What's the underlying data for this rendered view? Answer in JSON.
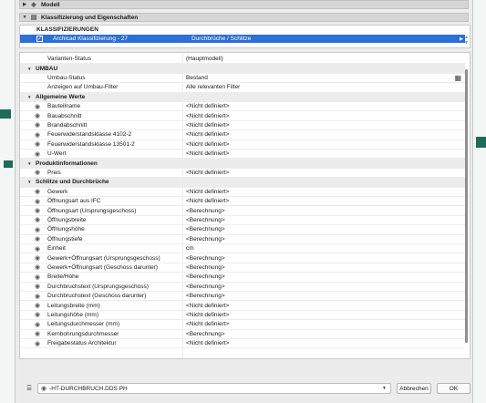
{
  "sections": {
    "modell": "Modell",
    "klassifizierung": "Klassifizierung und Eigenschaften"
  },
  "klassifizierungen": {
    "header": "KLASSIFIZIERUNGEN",
    "selected_name": "Archicad Klassifizierung - 27",
    "selected_value": "Durchbrüche / Schlitze"
  },
  "rows": [
    {
      "type": "prop",
      "name": "Varianten-Status",
      "value": "(Hauptmodell)",
      "eye": false
    },
    {
      "type": "group",
      "name": "UMBAU"
    },
    {
      "type": "prop",
      "name": "Umbau-Status",
      "value": "Bestand",
      "eye": false,
      "grid": true
    },
    {
      "type": "prop",
      "name": "Anzeigen auf Umbau-Filter",
      "value": "Alle relevanten Filter",
      "eye": false
    },
    {
      "type": "group",
      "name": "Allgemeine Werte"
    },
    {
      "type": "prop",
      "name": "Bauteilname",
      "value": "<Nicht definiert>",
      "eye": true
    },
    {
      "type": "prop",
      "name": "Bauabschnitt",
      "value": "<Nicht definiert>",
      "eye": true
    },
    {
      "type": "prop",
      "name": "Brandabschnitt",
      "value": "<Nicht definiert>",
      "eye": true
    },
    {
      "type": "prop",
      "name": "Feuerwiderstandsklasse 4102-2",
      "value": "<Nicht definiert>",
      "eye": true
    },
    {
      "type": "prop",
      "name": "Feuerwiderstandsklasse 13501-2",
      "value": "<Nicht definiert>",
      "eye": true
    },
    {
      "type": "prop",
      "name": "U-Wert",
      "value": "<Nicht definiert>",
      "eye": true
    },
    {
      "type": "group",
      "name": "Produktinformationen"
    },
    {
      "type": "prop",
      "name": "Preis",
      "value": "<Nicht definiert>",
      "eye": true
    },
    {
      "type": "group",
      "name": "Schlitze und Durchbrüche"
    },
    {
      "type": "prop",
      "name": "Gewerk",
      "value": "<Nicht definiert>",
      "eye": true
    },
    {
      "type": "prop",
      "name": "Öffnungsart aus IFC",
      "value": "<Nicht definiert>",
      "eye": true
    },
    {
      "type": "prop",
      "name": "Öffnungsart (Ursprungsgeschoss)",
      "value": "<Berechnung>",
      "eye": true
    },
    {
      "type": "prop",
      "name": "Öffnungsbreite",
      "value": "<Berechnung>",
      "eye": true
    },
    {
      "type": "prop",
      "name": "Öffnungshöhe",
      "value": "<Berechnung>",
      "eye": true
    },
    {
      "type": "prop",
      "name": "Öffnungstiefe",
      "value": "<Berechnung>",
      "eye": true
    },
    {
      "type": "prop",
      "name": "Einheit",
      "value": "cm",
      "eye": true
    },
    {
      "type": "prop",
      "name": "Gewerk+Öffnungsart (Ursprungsgeschoss)",
      "value": "<Berechnung>",
      "eye": true
    },
    {
      "type": "prop",
      "name": "Gewerk+Öffnungsart (Geschoss darunter)",
      "value": "<Berechnung>",
      "eye": true
    },
    {
      "type": "prop",
      "name": "Breite/Höhe",
      "value": "<Berechnung>",
      "eye": true
    },
    {
      "type": "prop",
      "name": "Durchbruchstext (Ursprungsgeschoss)",
      "value": "<Berechnung>",
      "eye": true
    },
    {
      "type": "prop",
      "name": "Durchbruchstext (Geschoss darunter)",
      "value": "<Berechnung>",
      "eye": true
    },
    {
      "type": "prop",
      "name": "Leitungsbreite (mm)",
      "value": "<Nicht definiert>",
      "eye": true
    },
    {
      "type": "prop",
      "name": "Leitungshöhe (mm)",
      "value": "<Nicht definiert>",
      "eye": true
    },
    {
      "type": "prop",
      "name": "Leitungsdurchmesser (mm)",
      "value": "<Nicht definiert>",
      "eye": true
    },
    {
      "type": "prop",
      "name": "Kernbohrungsdurchmesser",
      "value": "<Berechnung>",
      "eye": true
    },
    {
      "type": "prop",
      "name": "Freigabestatus Architektur",
      "value": "<Nicht definiert>",
      "eye": true
    }
  ],
  "footer": {
    "favorite_value": "-HT-DURCHBRUCH.DDS PH",
    "cancel_label": "Abbrechen",
    "ok_label": "OK"
  },
  "colors": {
    "selection": "#2d6fd6",
    "group_bg": "#ececec"
  }
}
